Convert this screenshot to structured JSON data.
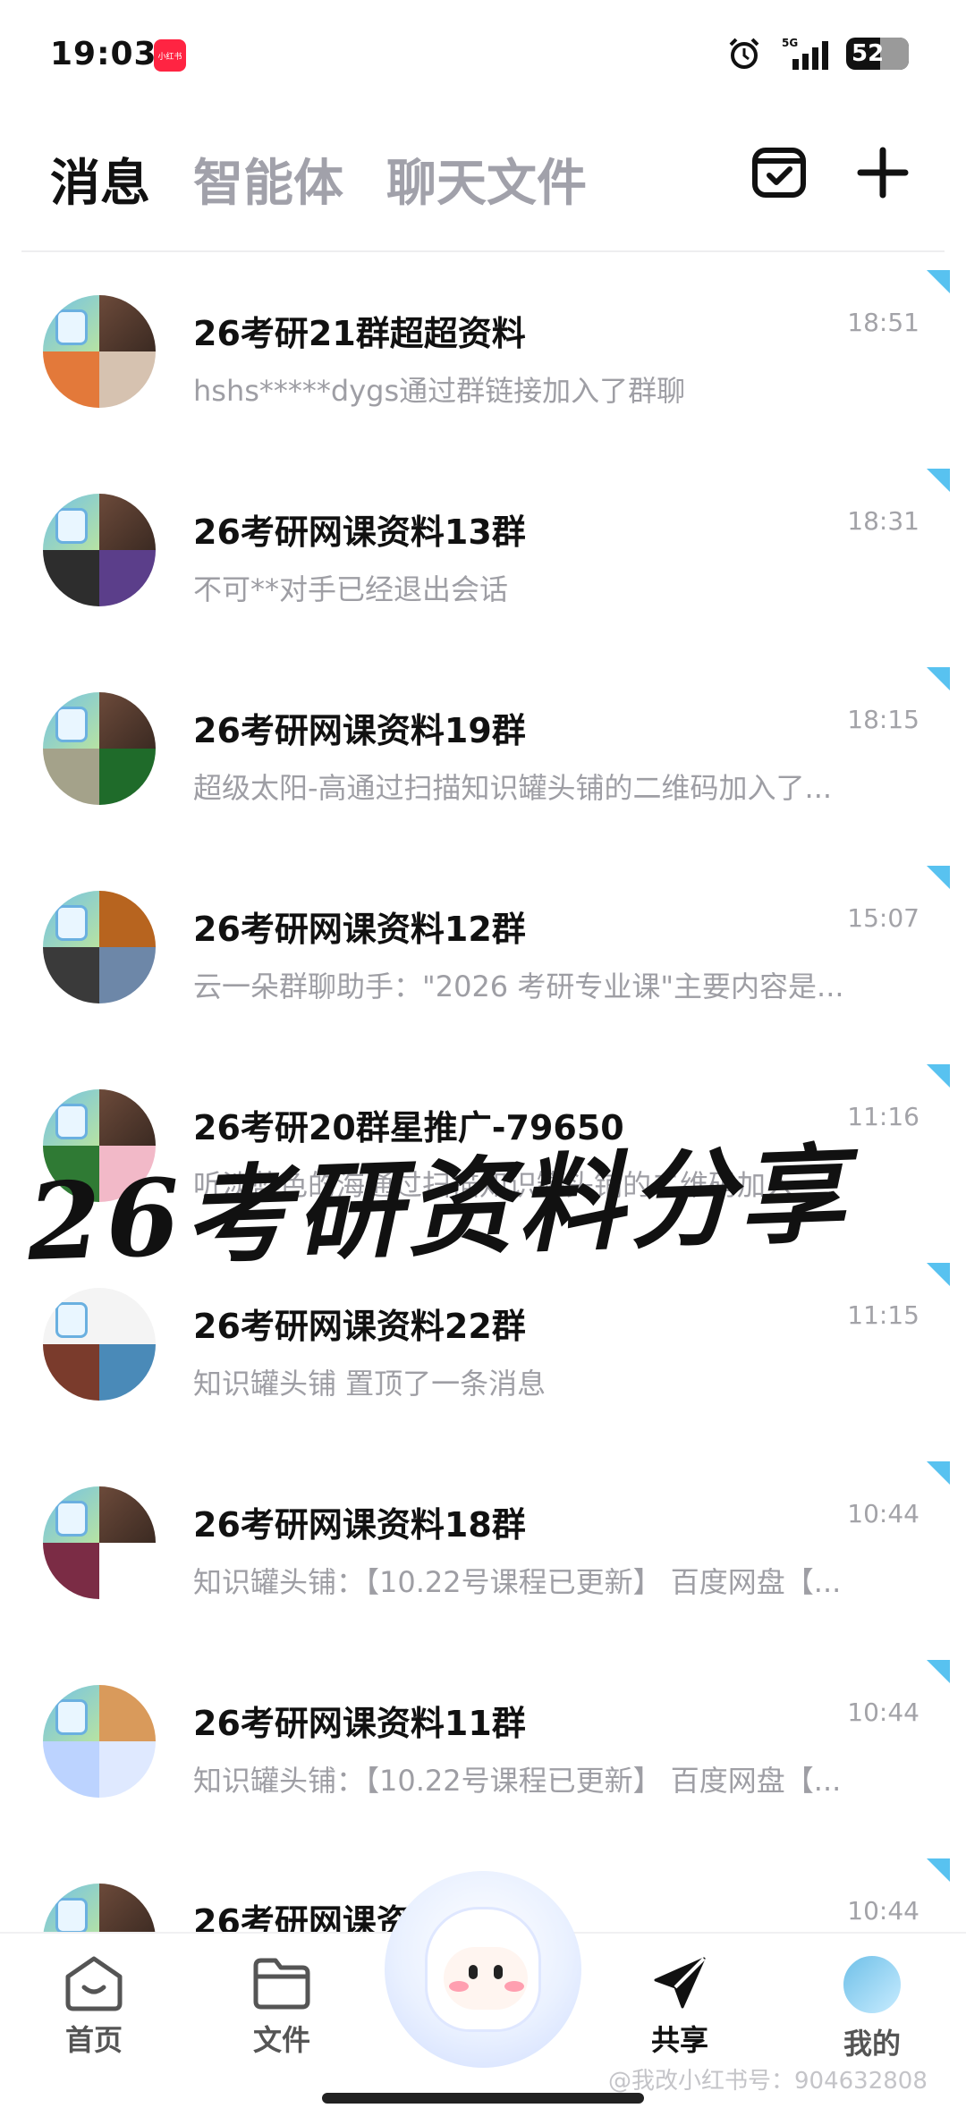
{
  "status_bar": {
    "time": "19:03",
    "app_badge": "小红书",
    "network": "5G",
    "battery": "52"
  },
  "header": {
    "tabs": [
      {
        "label": "消息",
        "active": true
      },
      {
        "label": "智能体",
        "active": false
      },
      {
        "label": "聊天文件",
        "active": false
      }
    ],
    "icons": [
      "inbox-check-icon",
      "plus-icon"
    ]
  },
  "chats": [
    {
      "name": "26考研21群超超资料",
      "time": "18:51",
      "preview": "hshs*****dygs通过群链接加入了群聊"
    },
    {
      "name": "26考研网课资料13群",
      "time": "18:31",
      "preview": "不可**对手已经退出会话"
    },
    {
      "name": "26考研网课资料19群",
      "time": "18:15",
      "preview": "超级太阳-高通过扫描知识罐头铺的二维码加入了..."
    },
    {
      "name": "26考研网课资料12群",
      "time": "15:07",
      "preview": "云一朵群聊助手：\"2026 考研专业课\"主要内容是..."
    },
    {
      "name": "26考研20群星推广-79650",
      "time": "11:16",
      "preview": "听淡蓝色的海通过扫描知识罐头铺的二维码加入"
    },
    {
      "name": "26考研网课资料22群",
      "time": "11:15",
      "preview": "知识罐头铺 置顶了一条消息"
    },
    {
      "name": "26考研网课资料18群",
      "time": "10:44",
      "preview": "知识罐头铺：【10.22号课程已更新】 百度网盘【..."
    },
    {
      "name": "26考研网课资料11群",
      "time": "10:44",
      "preview": "知识罐头铺：【10.22号课程已更新】 百度网盘【..."
    },
    {
      "name": "26考研网课资",
      "time": "10:44",
      "preview": ""
    }
  ],
  "overlay_text": "26考研资料分享",
  "bottom_nav": {
    "items": [
      {
        "label": "首页",
        "icon": "home-icon"
      },
      {
        "label": "文件",
        "icon": "folder-icon"
      },
      {
        "label": "共享",
        "icon": "send-icon"
      },
      {
        "label": "我的",
        "icon": "avatar"
      }
    ]
  },
  "footer_mark": "@我改小红书号：904632808"
}
